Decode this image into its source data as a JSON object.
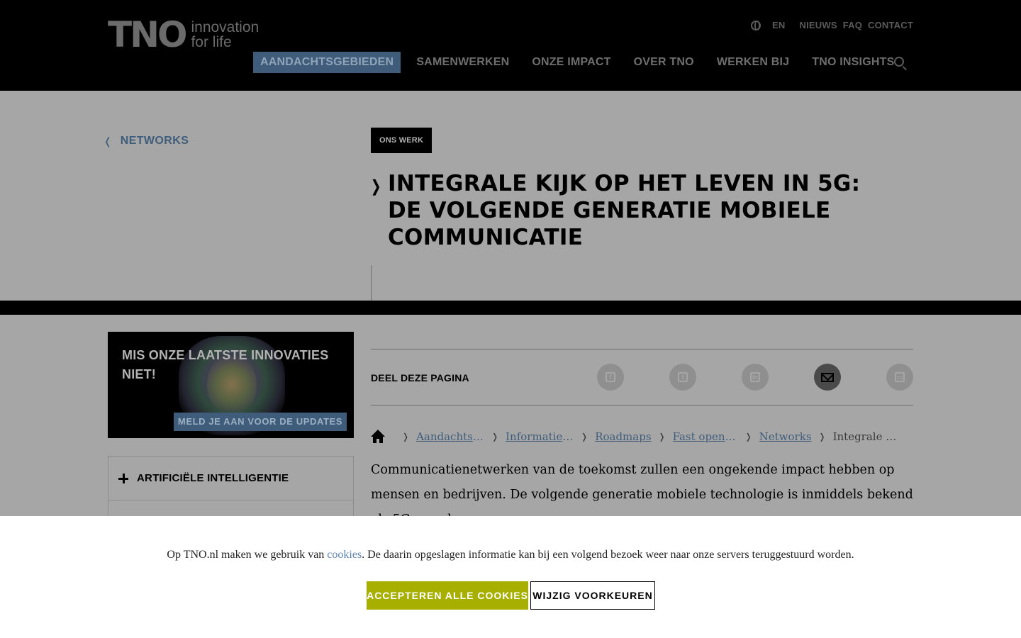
{
  "header": {
    "logo_mark": "TNO",
    "logo_tagline_1": "innovation",
    "logo_tagline_2": "for life",
    "top_links": {
      "language": "EN",
      "news": "NIEUWS",
      "faq": "FAQ",
      "contact": "CONTACT"
    },
    "nav": [
      {
        "label": "AANDACHTSGEBIEDEN",
        "active": true
      },
      {
        "label": "SAMENWERKEN",
        "active": false
      },
      {
        "label": "ONZE IMPACT",
        "active": false
      },
      {
        "label": "OVER TNO",
        "active": false
      },
      {
        "label": "WERKEN BIJ",
        "active": false
      },
      {
        "label": "TNO INSIGHTS",
        "active": false
      }
    ]
  },
  "hero": {
    "back_label": "NETWORKS",
    "tag": "ONS WERK",
    "title": "INTEGRALE KIJK OP HET LEVEN IN 5G: DE VOLGENDE GENERATIE MOBIELE COMMUNICATIE"
  },
  "promo": {
    "heading": "MIS ONZE LAATSTE INNOVATIES NIET!",
    "cta": "MELD JE AAN VOOR DE UPDATES"
  },
  "accordion": {
    "items": [
      {
        "label": "ARTIFICIËLE INTELLIGENTIE"
      }
    ]
  },
  "share": {
    "label": "DEEL DEZE PAGINA",
    "buttons": [
      "facebook",
      "twitter",
      "linkedin",
      "email",
      "print"
    ]
  },
  "breadcrumb": {
    "items": [
      "Aandachtsg…",
      "Informatie …",
      "Roadmaps",
      "Fast open i…",
      "Networks"
    ],
    "current": "Integrale ki…"
  },
  "intro": "Communicatienetwerken van de toekomst zullen een ongekende impact hebben op mensen en bedrijven. De volgende generatie mobiele technologie is inmiddels bekend als 5G en zal",
  "cookie": {
    "text_before": "Op TNO.nl maken we gebruik van ",
    "link": "cookies",
    "text_after": ". De daarin opgeslagen informatie kan bij een volgend bezoek weer naar onze servers teruggestuurd  worden.",
    "accept": "ACCEPTEREN ALLE COOKIES",
    "preferences": "WIJZIG VOORKEUREN"
  },
  "colors": {
    "accent_blue": "#3f5d7b",
    "accept_green": "#a7b000",
    "overlay_grey": "#a6a6a6"
  }
}
